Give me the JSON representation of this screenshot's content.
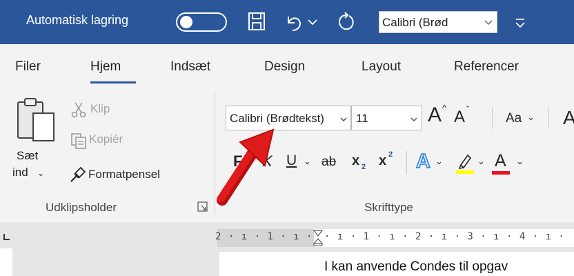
{
  "titlebar": {
    "autosave_label": "Automatisk lagring",
    "autosave_state": "off",
    "font_selector_value": "Calibri (Brød",
    "icons": [
      "save-icon",
      "undo-icon",
      "undo-dropdown-icon",
      "redo-icon",
      "customize-quick-access-icon"
    ]
  },
  "tabs": {
    "items": [
      "Filer",
      "Hjem",
      "Indsæt",
      "Design",
      "Layout",
      "Referencer"
    ],
    "active": "Hjem"
  },
  "clipboard": {
    "paste_label_1": "Sæt",
    "paste_label_2": "ind",
    "cut_label": "Klip",
    "copy_label": "Kopiér",
    "format_painter_label": "Formatpensel",
    "group_label": "Udklipsholder"
  },
  "font": {
    "font_name": "Calibri (Brødtekst)",
    "font_size": "11",
    "grow_label": "A",
    "shrink_label": "A",
    "case_label": "Aa",
    "clear_label": "A",
    "bold_label": "F",
    "italic_label": "K",
    "underline_label": "U",
    "strike_label": "ab",
    "subscript_label": "x",
    "superscript_label": "x",
    "text_effects_label": "A",
    "font_color_label": "A",
    "group_label": "Skrifttype",
    "highlight_color": "#ffff00",
    "font_color": "#e81123"
  },
  "ruler": {
    "left_text": "2 · ı · 1 · ı ·",
    "right_text": "· ı · 1 · ı · 2 · ı · 3 · ı · 4 · ı ·"
  },
  "document": {
    "visible_text": "I kan anvende Condes til opgav"
  },
  "colors": {
    "title_bar": "#2b579a",
    "ribbon_bg": "#f3f3f3",
    "annotation_arrow": "#e01b1b"
  }
}
